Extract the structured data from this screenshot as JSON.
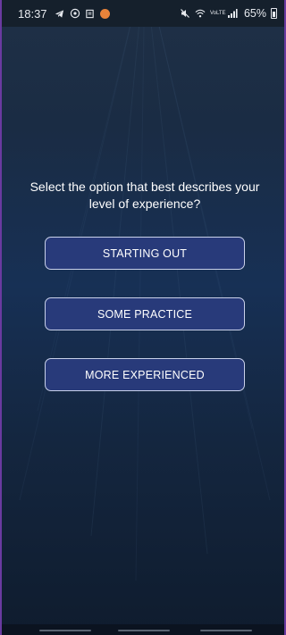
{
  "status_bar": {
    "time": "18:37",
    "network_label": "VoLTE",
    "battery_percent": "65%",
    "icons": [
      "telegram-icon",
      "whatsapp-icon",
      "document-icon",
      "app-badge-icon",
      "mute-icon",
      "wifi-icon",
      "signal-icon",
      "battery-icon"
    ]
  },
  "question": "Select the option that best describes your level of experience?",
  "options": [
    {
      "label": "STARTING OUT"
    },
    {
      "label": "SOME PRACTICE"
    },
    {
      "label": "MORE EXPERIENCED"
    }
  ],
  "colors": {
    "background_top": "#1f3046",
    "background_bottom": "#0f1c2e",
    "button_fill": "#283a7a",
    "button_border": "#c9d1ea",
    "text": "#ffffff"
  }
}
